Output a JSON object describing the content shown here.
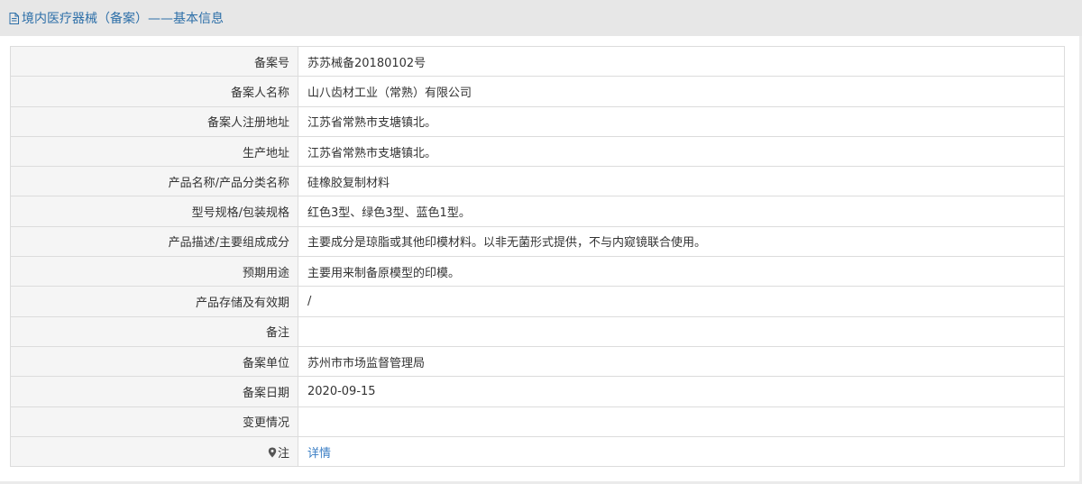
{
  "header": {
    "title": "境内医疗器械（备案）——基本信息",
    "icon": "document-icon",
    "color": "#2d6fa8"
  },
  "rows": [
    {
      "label": "备案号",
      "value": "苏苏械备20180102号"
    },
    {
      "label": "备案人名称",
      "value": "山八齿材工业（常熟）有限公司"
    },
    {
      "label": "备案人注册地址",
      "value": "江苏省常熟市支塘镇北。"
    },
    {
      "label": "生产地址",
      "value": "江苏省常熟市支塘镇北。"
    },
    {
      "label": "产品名称/产品分类名称",
      "value": "硅橡胶复制材料"
    },
    {
      "label": "型号规格/包装规格",
      "value": "红色3型、绿色3型、蓝色1型。"
    },
    {
      "label": "产品描述/主要组成成分",
      "value": "主要成分是琼脂或其他印模材料。以非无菌形式提供，不与内窥镜联合使用。"
    },
    {
      "label": "预期用途",
      "value": "主要用来制备原模型的印模。"
    },
    {
      "label": "产品存储及有效期",
      "value": "/"
    },
    {
      "label": "备注",
      "value": ""
    },
    {
      "label": "备案单位",
      "value": "苏州市市场监督管理局"
    },
    {
      "label": "备案日期",
      "value": "2020-09-15"
    },
    {
      "label": "变更情况",
      "value": ""
    },
    {
      "label": "注",
      "icon": "location-pin-icon",
      "value": "详情"
    }
  ],
  "colors": {
    "label_bg": "#f5f5f5",
    "border": "#dcdcdc",
    "link": "#3a7ec4"
  }
}
